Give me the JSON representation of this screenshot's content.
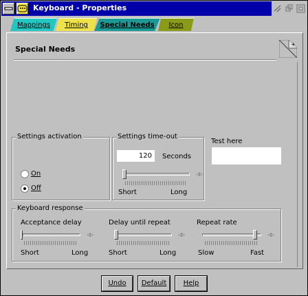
{
  "window": {
    "title": "Keyboard - Properties"
  },
  "tabs": [
    {
      "label": "Mappings"
    },
    {
      "label": "Timing"
    },
    {
      "label": "Special Needs"
    },
    {
      "label": "Icon"
    }
  ],
  "page": {
    "title": "Special Needs"
  },
  "settings_activation": {
    "label": "Settings activation",
    "on_label": "On",
    "off_label": "Off",
    "selected": "Off"
  },
  "settings_timeout": {
    "label": "Settings time-out",
    "value": "120",
    "unit": "Seconds",
    "short_label": "Short",
    "long_label": "Long",
    "level": 0.0
  },
  "test_here": {
    "label": "Test here",
    "value": ""
  },
  "keyboard_response": {
    "label": "Keyboard response",
    "acceptance_delay": {
      "label": "Acceptance delay",
      "min_label": "Short",
      "max_label": "Long",
      "level": 0.0
    },
    "delay_until_repeat": {
      "label": "Delay until repeat",
      "min_label": "Short",
      "max_label": "Long",
      "level": 0.0
    },
    "repeat_rate": {
      "label": "Repeat rate",
      "min_label": "Slow",
      "max_label": "Fast",
      "level": 1.0
    }
  },
  "buttons": {
    "undo": "Undo",
    "default": "Default",
    "help": "Help"
  },
  "colors": {
    "titlebar": "#0000aa",
    "tab_mappings": "#22c7c2",
    "tab_timing": "#ede24a",
    "tab_special": "#1b9a95",
    "tab_icon": "#8a9a19"
  }
}
